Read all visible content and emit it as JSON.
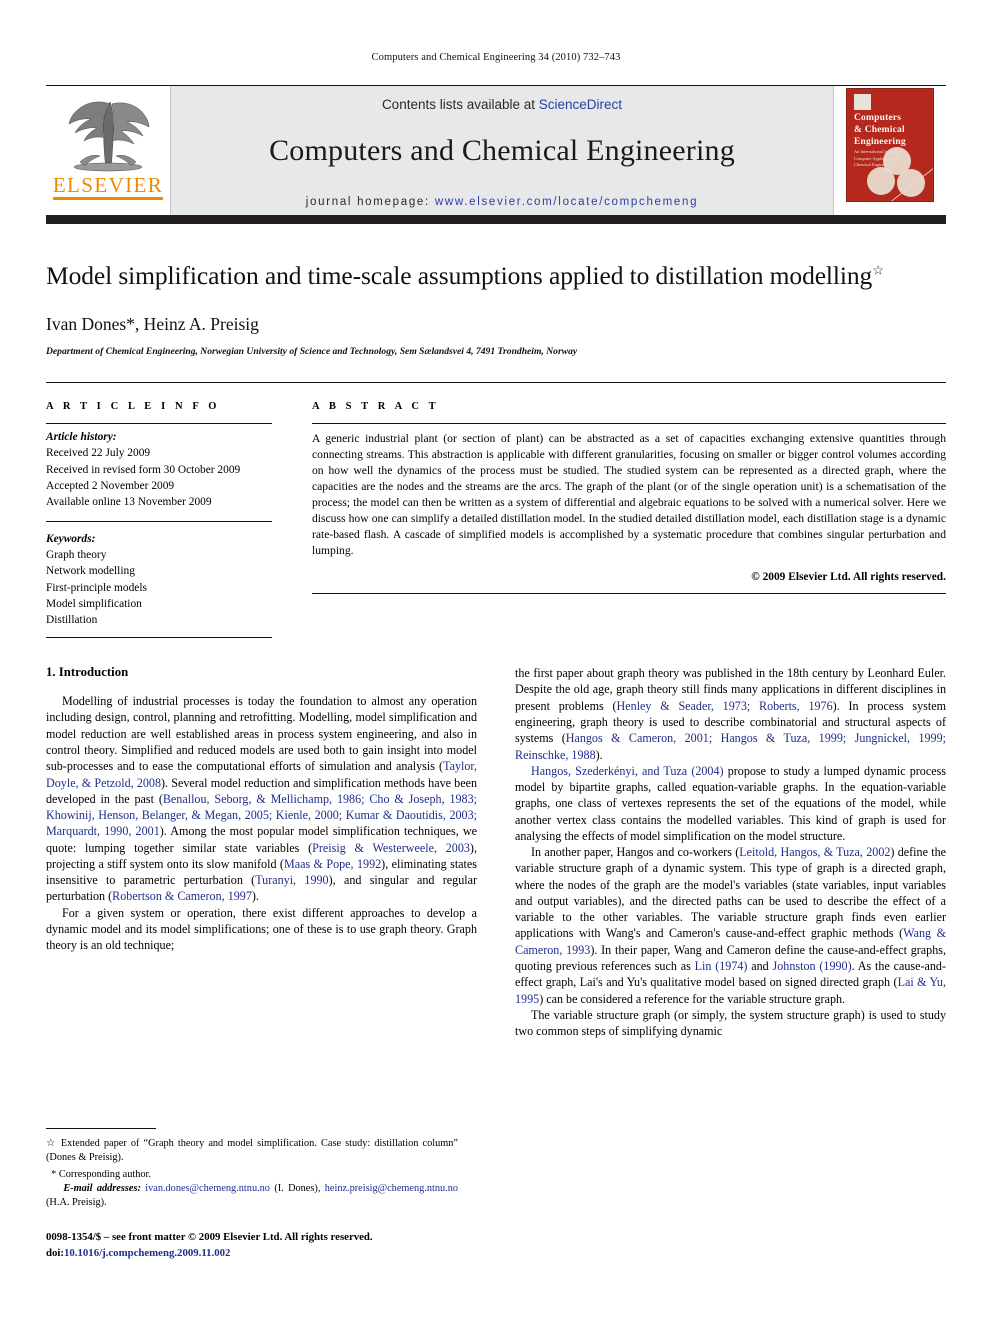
{
  "running_head": "Computers and Chemical Engineering 34 (2010) 732–743",
  "masthead": {
    "publisher_name": "ELSEVIER",
    "contents_prefix": "Contents lists available at ",
    "contents_link": "ScienceDirect",
    "journal_title": "Computers and Chemical Engineering",
    "homepage_label": "journal homepage:",
    "homepage_url": "www.elsevier.com/locate/compchemeng",
    "cover": {
      "title_line1": "Computers",
      "title_line2": "& Chemical",
      "title_line3": "Engineering",
      "subtitle": "An International Journal of Computer Applications in Chemical Engineering",
      "color": "#b5281e"
    },
    "brand_color": "#ED8B00",
    "link_color": "#2b3f9e"
  },
  "article": {
    "title": "Model simplification and time-scale assumptions applied to distillation modelling",
    "title_footnote_marker": "☆",
    "authors": "Ivan Dones*, Heinz A. Preisig",
    "affiliation": "Department of Chemical Engineering, Norwegian University of Science and Technology, Sem Sælandsvei 4, 7491 Trondheim, Norway"
  },
  "info": {
    "label": "A R T I C L E    I N F O",
    "history_label": "Article history:",
    "history": [
      "Received 22 July 2009",
      "Received in revised form 30 October 2009",
      "Accepted 2 November 2009",
      "Available online 13 November 2009"
    ],
    "keywords_label": "Keywords:",
    "keywords": [
      "Graph theory",
      "Network modelling",
      "First-principle models",
      "Model simplification",
      "Distillation"
    ]
  },
  "abstract": {
    "label": "A B S T R A C T",
    "text": "A generic industrial plant (or section of plant) can be abstracted as a set of capacities exchanging extensive quantities through connecting streams. This abstraction is applicable with different granularities, focusing on smaller or bigger control volumes according on how well the dynamics of the process must be studied. The studied system can be represented as a directed graph, where the capacities are the nodes and the streams are the arcs. The graph of the plant (or of the single operation unit) is a schematisation of the process; the model can then be written as a system of differential and algebraic equations to be solved with a numerical solver. Here we discuss how one can simplify a detailed distillation model. In the studied detailed distillation model, each distillation stage is a dynamic rate-based flash. A cascade of simplified models is accomplished by a systematic procedure that combines singular perturbation and lumping.",
    "copyright": "© 2009 Elsevier Ltd. All rights reserved."
  },
  "body": {
    "section_number_title": "1. Introduction",
    "left_paragraphs": [
      {
        "parts": [
          {
            "t": "Modelling of industrial processes is today the foundation to almost any operation including design, control, planning and retrofitting. Modelling, model simplification and model reduction are well established areas in process system engineering, and also in control theory. Simplified and reduced models are used both to gain insight into model sub-processes and to ease the computational efforts of simulation and analysis ("
          },
          {
            "t": "Taylor, Doyle, & Petzold, 2008",
            "ref": true
          },
          {
            "t": "). Several model reduction and simplification methods have been developed in the past ("
          },
          {
            "t": "Benallou, Seborg, & Mellichamp, 1986; Cho & Joseph, 1983; Khowinij, Henson, Belanger, & Megan, 2005; Kienle, 2000; Kumar & Daoutidis, 2003; Marquardt, 1990, 2001",
            "ref": true
          },
          {
            "t": "). Among the most popular model simplification techniques, we quote: lumping together similar state variables ("
          },
          {
            "t": "Preisig & Westerweele, 2003",
            "ref": true
          },
          {
            "t": "), projecting a stiff system onto its slow manifold ("
          },
          {
            "t": "Maas & Pope, 1992",
            "ref": true
          },
          {
            "t": "), eliminating states insensitive to parametric perturbation ("
          },
          {
            "t": "Turanyi, 1990",
            "ref": true
          },
          {
            "t": "), and singular and regular perturbation ("
          },
          {
            "t": "Robertson & Cameron, 1997",
            "ref": true
          },
          {
            "t": ")."
          }
        ]
      },
      {
        "parts": [
          {
            "t": "For a given system or operation, there exist different approaches to develop a dynamic model and its model simplifications; one of these is to use graph theory. Graph theory is an old technique;"
          }
        ]
      }
    ],
    "right_paragraphs": [
      {
        "first": true,
        "parts": [
          {
            "t": "the first paper about graph theory was published in the 18th century by Leonhard Euler. Despite the old age, graph theory still finds many applications in different disciplines in present problems ("
          },
          {
            "t": "Henley & Seader, 1973; Roberts, 1976",
            "ref": true
          },
          {
            "t": "). In process system engineering, graph theory is used to describe combinatorial and structural aspects of systems ("
          },
          {
            "t": "Hangos & Cameron, 2001; Hangos & Tuza, 1999; Jungnickel, 1999; Reinschke, 1988",
            "ref": true
          },
          {
            "t": ")."
          }
        ]
      },
      {
        "parts": [
          {
            "t": "Hangos, Szederkényi, and Tuza (2004)",
            "ref": true
          },
          {
            "t": " propose to study a lumped dynamic process model by bipartite graphs, called equation-variable graphs. In the equation-variable graphs, one class of vertexes represents the set of the equations of the model, while another vertex class contains the modelled variables. This kind of graph is used for analysing the effects of model simplification on the model structure."
          }
        ]
      },
      {
        "parts": [
          {
            "t": "In another paper, Hangos and co-workers ("
          },
          {
            "t": "Leitold, Hangos, & Tuza, 2002",
            "ref": true
          },
          {
            "t": ") define the variable structure graph of a dynamic system. This type of graph is a directed graph, where the nodes of the graph are the model's variables (state variables, input variables and output variables), and the directed paths can be used to describe the effect of a variable to the other variables. The variable structure graph finds even earlier applications with Wang's and Cameron's cause-and-effect graphic methods ("
          },
          {
            "t": "Wang & Cameron, 1993",
            "ref": true
          },
          {
            "t": "). In their paper, Wang and Cameron define the cause-and-effect graphs, quoting previous references such as "
          },
          {
            "t": "Lin (1974)",
            "ref": true
          },
          {
            "t": " and "
          },
          {
            "t": "Johnston (1990)",
            "ref": true
          },
          {
            "t": ". As the cause-and-effect graph, Lai's and Yu's qualitative model based on signed directed graph ("
          },
          {
            "t": "Lai & Yu, 1995",
            "ref": true
          },
          {
            "t": ") can be considered a reference for the variable structure graph."
          }
        ]
      },
      {
        "parts": [
          {
            "t": "The variable structure graph (or simply, the system structure graph) is used to study two common steps of simplifying dynamic"
          }
        ]
      }
    ]
  },
  "footnotes": {
    "star_note_marker": "☆",
    "star_note": "Extended paper of “Graph theory and model simplification. Case study: distillation column” (Dones & Preisig).",
    "corresponding_marker": "*",
    "corresponding": "Corresponding author.",
    "email_label": "E-mail addresses:",
    "email1": "ivan.dones@chemeng.ntnu.no",
    "email1_owner": "(I. Dones),",
    "email2": "heinz.preisig@chemeng.ntnu.no",
    "email2_owner": "(H.A. Preisig).",
    "imprint_line": "0098-1354/$ – see front matter © 2009 Elsevier Ltd. All rights reserved.",
    "doi_label": "doi:",
    "doi": "10.1016/j.compchemeng.2009.11.002"
  }
}
